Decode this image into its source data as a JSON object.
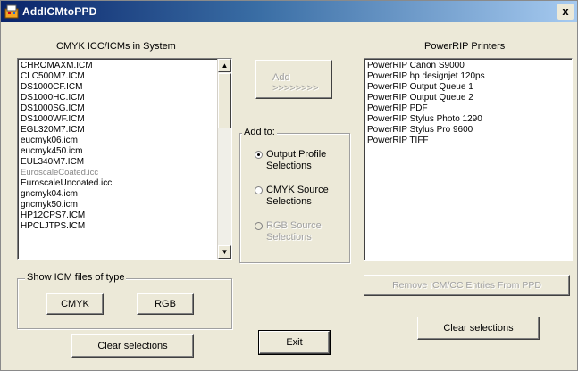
{
  "window": {
    "title": "AddICMtoPPD",
    "close_label": "x"
  },
  "left": {
    "header": "CMYK ICC/ICMs in System",
    "items": [
      "CHROMAXM.ICM",
      "CLC500M7.ICM",
      "DS1000CF.ICM",
      "DS1000HC.ICM",
      "DS1000SG.ICM",
      "DS1000WF.ICM",
      "EGL320M7.ICM",
      "eucmyk06.icm",
      "eucmyk450.icm",
      "EUL340M7.ICM",
      "EuroscaleCoated.icc",
      "EuroscaleUncoated.icc",
      "gncmyk04.icm",
      "gncmyk50.icm",
      "HP12CPS7.ICM",
      "HPCLJTPS.ICM"
    ],
    "show_group_caption": "Show ICM files of type",
    "cmyk_label": "CMYK",
    "rgb_label": "RGB",
    "clear_label": "Clear selections"
  },
  "middle": {
    "add_label_line1": "Add",
    "add_label_line2": ">>>>>>>>",
    "add_to_caption": "Add to:",
    "radios": [
      {
        "line1": "Output Profile",
        "line2": "Selections",
        "checked": true,
        "disabled": false
      },
      {
        "line1": "CMYK Source",
        "line2": "Selections",
        "checked": false,
        "disabled": false
      },
      {
        "line1": "RGB Source",
        "line2": "Selections",
        "checked": false,
        "disabled": true
      }
    ],
    "exit_label": "Exit"
  },
  "right": {
    "header": "PowerRIP Printers",
    "items": [
      "PowerRIP Canon S9000",
      "PowerRIP hp designjet 120ps",
      "PowerRIP Output Queue 1",
      "PowerRIP Output Queue 2",
      "PowerRIP PDF",
      "PowerRIP Stylus Photo 1290",
      "PowerRIP Stylus Pro 9600",
      "PowerRIP TIFF"
    ],
    "remove_label": "Remove ICM/CC Entries From PPD",
    "clear_label": "Clear selections"
  },
  "icons": {
    "app": "app-icon",
    "scroll_up": "scroll-up-arrow-icon",
    "scroll_down": "scroll-down-arrow-icon"
  },
  "colors": {
    "titlebar_start": "#0a246a",
    "titlebar_end": "#a6caf0",
    "face": "#ece9d8"
  }
}
